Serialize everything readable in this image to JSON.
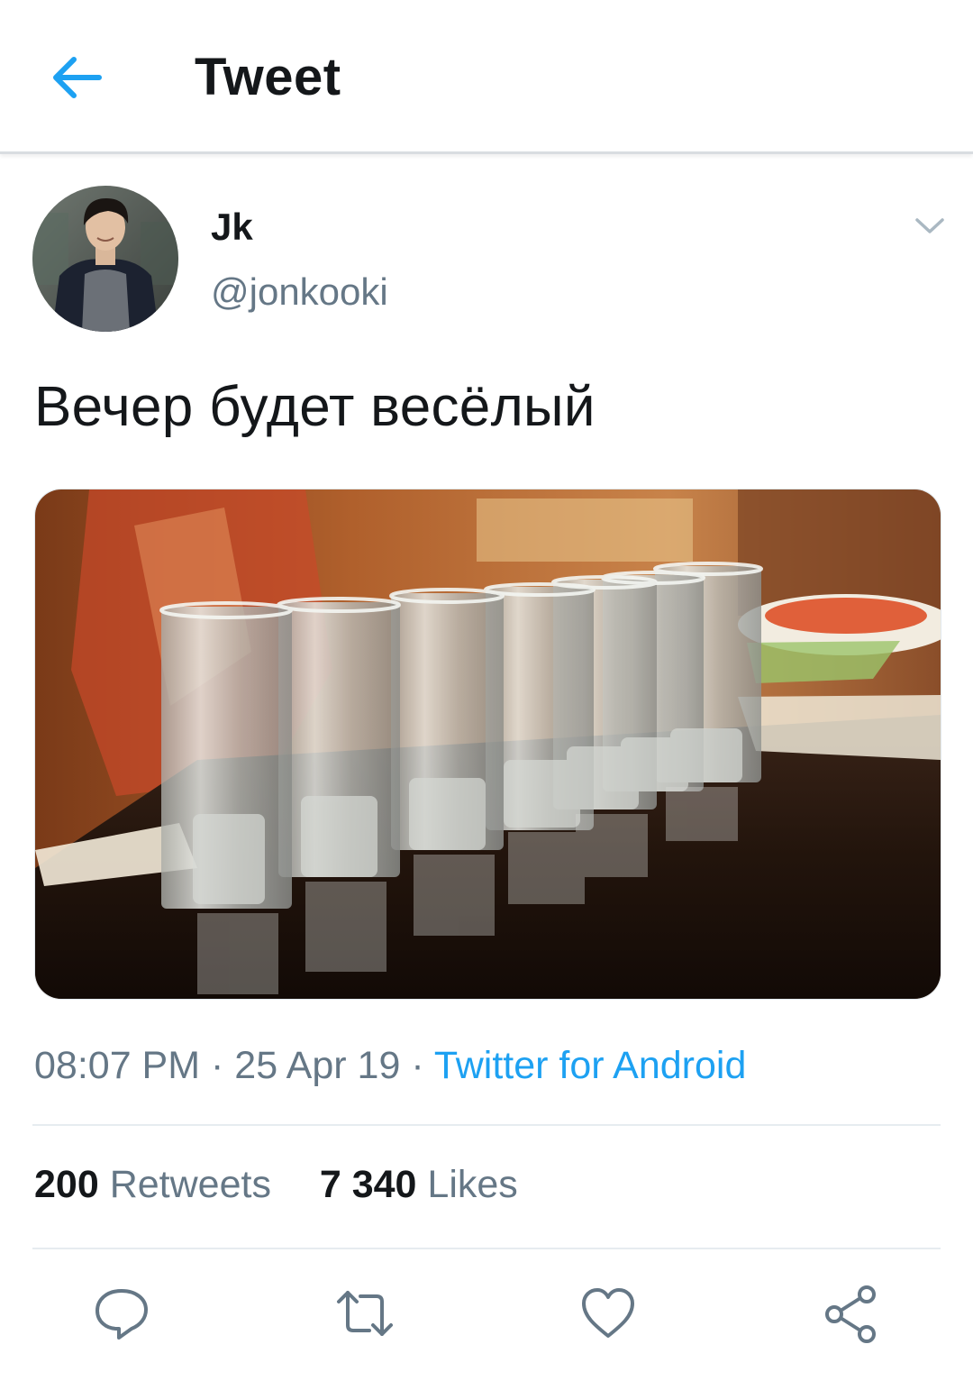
{
  "header": {
    "title": "Tweet",
    "back_icon": "arrow-left-icon",
    "accent": "#1da1f2"
  },
  "author": {
    "display_name": "Jk",
    "handle": "@jonkooki"
  },
  "tweet": {
    "text": "Вечер будет весёлый",
    "time": "08:07 PM",
    "separator": " · ",
    "date": "25 Apr 19",
    "source": "Twitter for Android"
  },
  "stats": {
    "retweets_count": "200",
    "retweets_label": "Retweets",
    "likes_count": "7 340",
    "likes_label": "Likes"
  },
  "actions": [
    "reply-icon",
    "retweet-icon",
    "like-icon",
    "share-icon"
  ],
  "colors": {
    "text": "#14171a",
    "secondary": "#657786",
    "link": "#1da1f2",
    "divider": "#e6ecf0"
  }
}
